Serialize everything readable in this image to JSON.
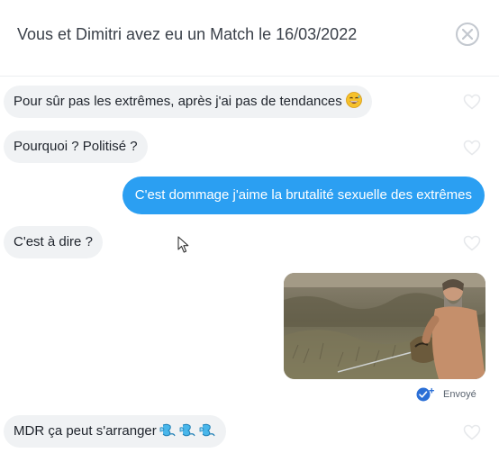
{
  "header": {
    "title": "Vous et Dimitri avez eu un Match le 16/03/2022",
    "close_icon": "close-circle-icon"
  },
  "messages": [
    {
      "direction": "in",
      "text": "Pour sûr pas les extrêmes, après j'ai pas de tendances",
      "emoji": "grinning-sweat-emoji"
    },
    {
      "direction": "in",
      "text": "Pourquoi ? Politisé ?"
    },
    {
      "direction": "out",
      "text": "C'est dommage j'aime la brutalité sexuelle des extrêmes"
    },
    {
      "direction": "in",
      "text": "C'est à dire ?"
    },
    {
      "direction": "out",
      "type": "image",
      "image_description": "photo-attachment"
    },
    {
      "direction": "in",
      "text": "MDR ça peut s'arranger",
      "emoji": "sweat-droplets-emoji"
    }
  ],
  "status": {
    "label": "Envoyé",
    "icon": "double-check-icon"
  },
  "colors": {
    "outgoing_bubble": "#2b9ff2",
    "incoming_bubble": "#f0f2f4",
    "header_text": "#3a4049",
    "heart_outline": "#e6e8eb"
  }
}
